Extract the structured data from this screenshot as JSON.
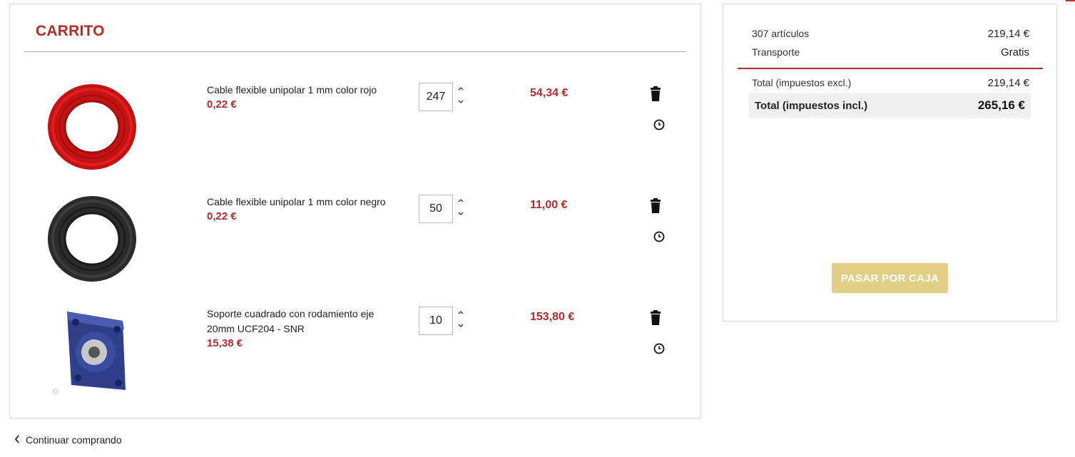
{
  "cart": {
    "title": "CARRITO",
    "items": [
      {
        "name": "Cable flexible unipolar 1 mm color rojo",
        "unit_price": "0,22 €",
        "quantity": "247",
        "total": "54,34 €",
        "image": "red-cable-coil"
      },
      {
        "name": "Cable flexible unipolar 1 mm color negro",
        "unit_price": "0,22 €",
        "quantity": "50",
        "total": "11,00 €",
        "image": "black-cable-coil"
      },
      {
        "name": "Soporte cuadrado con rodamiento eje 20mm UCF204 - SNR",
        "unit_price": "15,38 €",
        "quantity": "10",
        "total": "153,80 €",
        "image": "square-bearing-housing"
      }
    ]
  },
  "summary": {
    "items_label": "307 artículos",
    "items_value": "219,14 €",
    "shipping_label": "Transporte",
    "shipping_value": "Gratis",
    "total_excl_label": "Total (impuestos excl.)",
    "total_excl_value": "219,14 €",
    "total_incl_label": "Total (impuestos incl.)",
    "total_incl_value": "265,16 €",
    "checkout_label": "PASAR POR CAJA"
  },
  "footer": {
    "continue_label": "Continuar comprando"
  },
  "colors": {
    "accent": "#b52a2a",
    "checkout_bg": "#e1cf85"
  },
  "icons": [
    "trash-icon",
    "clock-icon",
    "chevron-up-icon",
    "chevron-down-icon",
    "chevron-left-icon"
  ]
}
